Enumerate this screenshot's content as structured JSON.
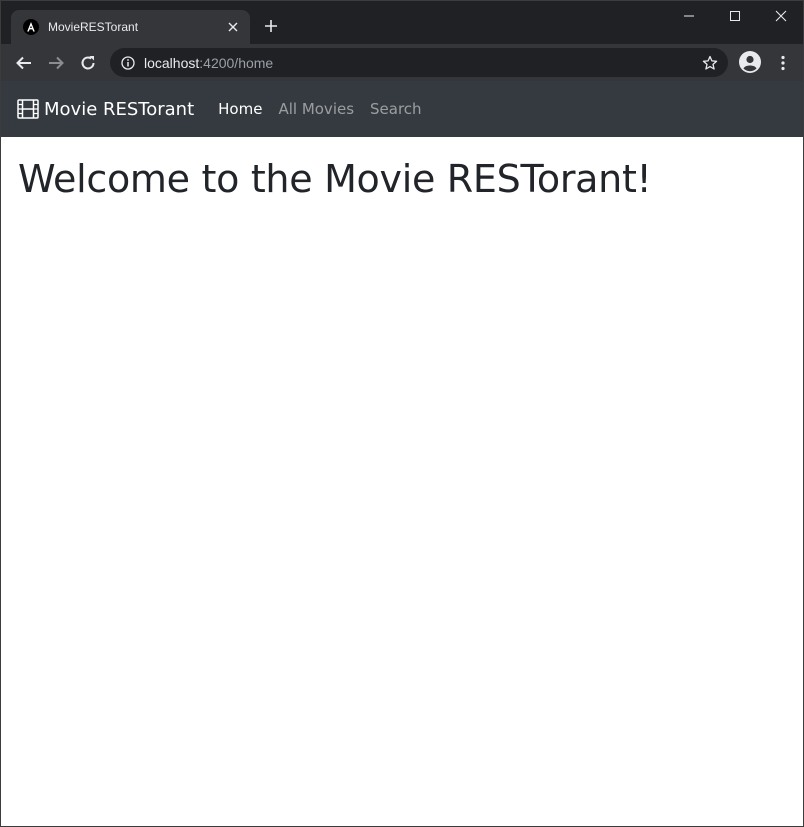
{
  "browser": {
    "tab": {
      "title": "MovieRESTorant",
      "favicon": "angular-icon"
    },
    "new_tab_icon": "plus-icon",
    "window_controls": [
      "minimize-icon",
      "maximize-icon",
      "close-icon"
    ],
    "url": {
      "host": "localhost",
      "rest": ":4200/home"
    },
    "colors": {
      "frame": "#202124",
      "toolbar": "#35363a",
      "text": "#e8eaed",
      "muted": "#9aa0a6"
    }
  },
  "page": {
    "navbar": {
      "brand_icon": "film-icon",
      "brand": "Movie RESTorant",
      "links": [
        {
          "label": "Home",
          "active": true
        },
        {
          "label": "All Movies",
          "active": false
        },
        {
          "label": "Search",
          "active": false
        }
      ],
      "background": "#343a40"
    },
    "heading": "Welcome to the Movie RESTorant!"
  }
}
